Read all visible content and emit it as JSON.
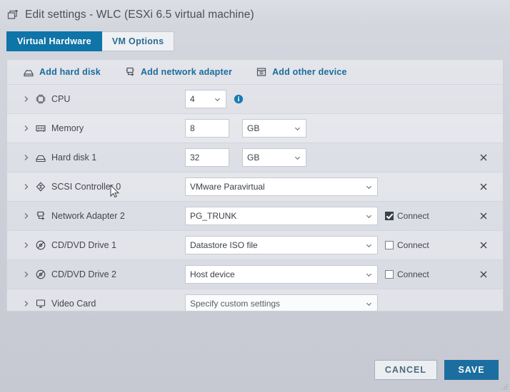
{
  "window": {
    "title": "Edit settings - WLC (ESXi 6.5 virtual machine)",
    "icon": "vm-window-icon"
  },
  "tabs": [
    {
      "label": "Virtual Hardware",
      "active": true
    },
    {
      "label": "VM Options",
      "active": false
    }
  ],
  "toolbar": {
    "add_hard_disk": "Add hard disk",
    "add_network_adapter": "Add network adapter",
    "add_other_device": "Add other device"
  },
  "devices": [
    {
      "name": "CPU",
      "icon": "cpu-icon",
      "control": "select",
      "value": "4",
      "has_info": true
    },
    {
      "name": "Memory",
      "icon": "memory-icon",
      "control": "number-unit",
      "value": "8",
      "unit": "GB"
    },
    {
      "name": "Hard disk 1",
      "icon": "hard-disk-icon",
      "control": "number-unit",
      "value": "32",
      "unit": "GB",
      "removable": true
    },
    {
      "name": "SCSI Controller 0",
      "icon": "scsi-controller-icon",
      "control": "select-wide",
      "value": "VMware Paravirtual",
      "removable": true
    },
    {
      "name": "Network Adapter 2",
      "icon": "network-adapter-icon",
      "control": "select-wide",
      "value": "PG_TRUNK",
      "connect_label": "Connect",
      "connected": true,
      "removable": true
    },
    {
      "name": "CD/DVD Drive 1",
      "icon": "cd-dvd-icon",
      "control": "select-wide",
      "value": "Datastore ISO file",
      "connect_label": "Connect",
      "connected": false,
      "removable": true
    },
    {
      "name": "CD/DVD Drive 2",
      "icon": "cd-dvd-icon",
      "control": "select-wide",
      "value": "Host device",
      "connect_label": "Connect",
      "connected": false,
      "removable": true
    },
    {
      "name": "Video Card",
      "icon": "video-card-icon",
      "control": "select-wide-muted",
      "value": "Specify custom settings"
    }
  ],
  "footer": {
    "cancel_label": "CANCEL",
    "save_label": "SAVE"
  },
  "colors": {
    "accent": "#0f74a8",
    "save_button": "#1b6e9f",
    "link": "#1a6c9c",
    "dialog_bg": "#cdcfd8",
    "panel_bg": "#dfe1e7"
  }
}
